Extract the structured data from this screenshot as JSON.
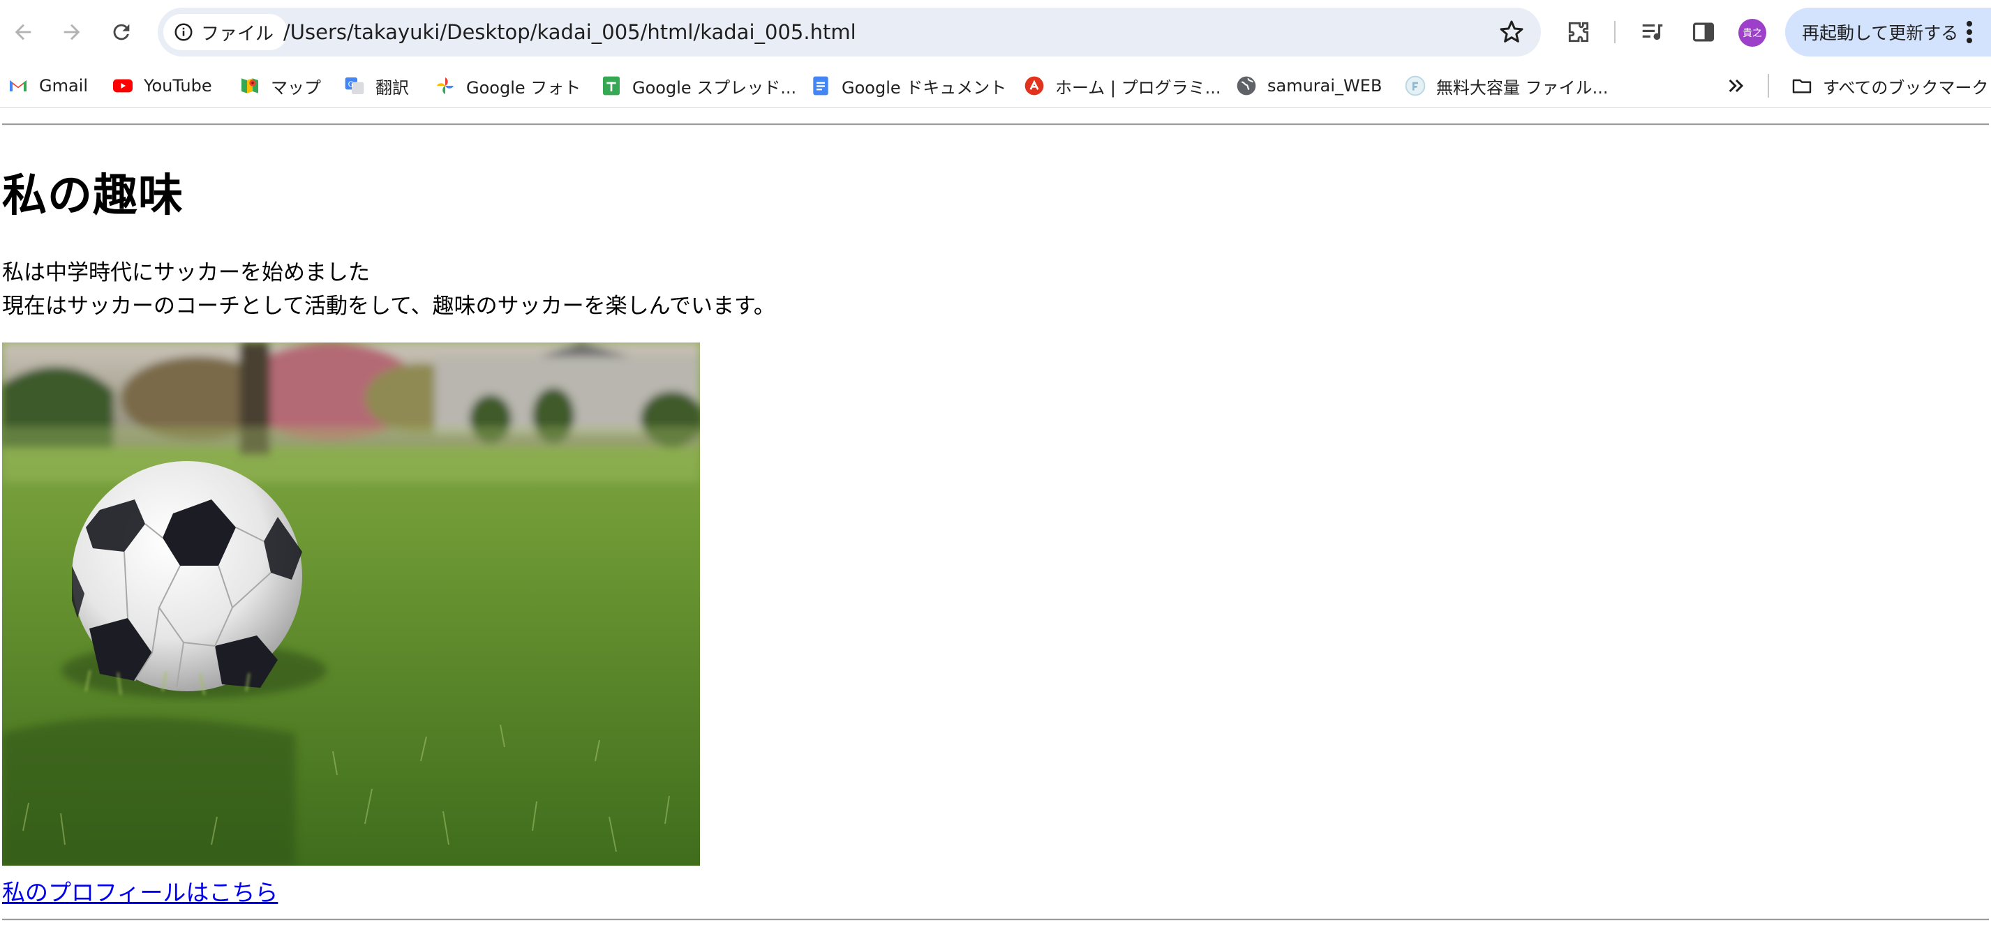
{
  "toolbar": {
    "site_chip_label": "ファイル",
    "url": "/Users/takayuki/Desktop/kadai_005/html/kadai_005.html",
    "avatar_text": "貴之",
    "update_button_label": "再起動して更新する"
  },
  "bookmarks": [
    {
      "label": "Gmail",
      "icon": "gmail-icon"
    },
    {
      "label": "YouTube",
      "icon": "youtube-icon"
    },
    {
      "label": "マップ",
      "icon": "maps-icon"
    },
    {
      "label": "翻訳",
      "icon": "translate-icon"
    },
    {
      "label": "Google フォト",
      "icon": "photos-icon"
    },
    {
      "label": "Google スプレッド...",
      "icon": "sheets-icon"
    },
    {
      "label": "Google ドキュメント",
      "icon": "docs-icon"
    },
    {
      "label": "ホーム | プログラミ...",
      "icon": "samurai-icon"
    },
    {
      "label": "samurai_WEB",
      "icon": "globe-icon"
    },
    {
      "label": "無料大容量 ファイル...",
      "icon": "file-transfer-icon"
    }
  ],
  "all_bookmarks_label": "すべてのブックマーク",
  "page": {
    "heading": "私の趣味",
    "line1": "私は中学時代にサッカーを始めました",
    "line2": "現在はサッカーのコーチとして活動をして、趣味のサッカーを楽しんでいます。",
    "image_subject": "soccer ball on grass",
    "link_text": "私のプロフィールはこちら"
  }
}
